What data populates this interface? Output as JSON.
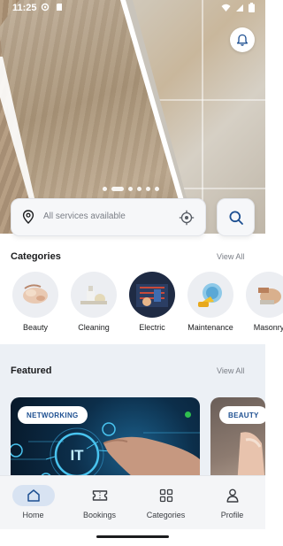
{
  "status_bar": {
    "time": "11:25"
  },
  "hero": {
    "slide_count": 6,
    "active_slide": 1
  },
  "search": {
    "placeholder": "All services available"
  },
  "categories": {
    "title": "Categories",
    "view_all": "View All",
    "items": [
      {
        "label": "Beauty",
        "icon": "beauty-photo"
      },
      {
        "label": "Cleaning",
        "icon": "cleaning-photo"
      },
      {
        "label": "Electric",
        "icon": "electric-photo"
      },
      {
        "label": "Maintenance",
        "icon": "maintenance-photo"
      },
      {
        "label": "Masonry",
        "icon": "masonry-photo"
      }
    ]
  },
  "featured": {
    "title": "Featured",
    "view_all": "View All",
    "cards": [
      {
        "badge": "NETWORKING",
        "overlay": "IT",
        "status_color": "#2fbf4f"
      },
      {
        "badge": "BEAUTY"
      }
    ]
  },
  "nav": {
    "items": [
      {
        "label": "Home",
        "icon": "home-icon",
        "active": true
      },
      {
        "label": "Bookings",
        "icon": "ticket-icon",
        "active": false
      },
      {
        "label": "Categories",
        "icon": "grid-icon",
        "active": false
      },
      {
        "label": "Profile",
        "icon": "person-icon",
        "active": false
      }
    ]
  },
  "colors": {
    "accent": "#1d4f91",
    "nav_active_bg": "#d8e3f2",
    "featured_bg": "#ecf0f5"
  }
}
